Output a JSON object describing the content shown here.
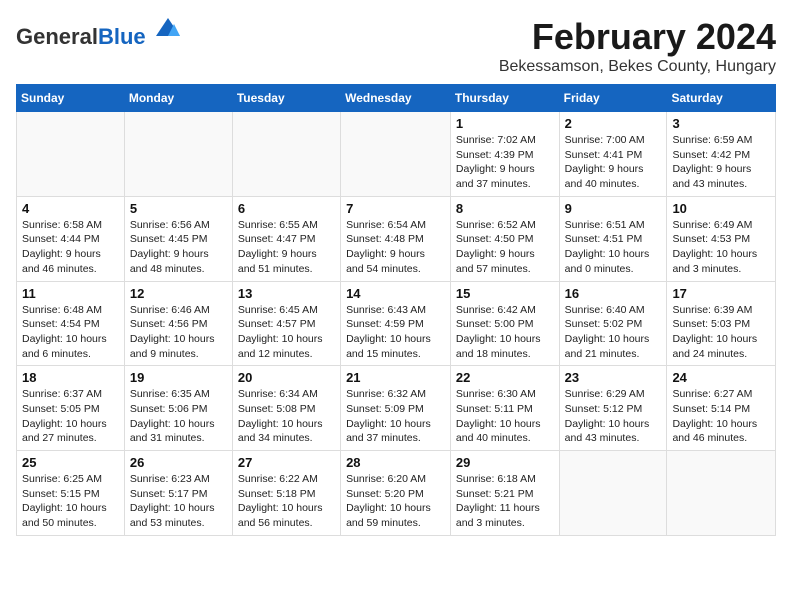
{
  "header": {
    "logo_general": "General",
    "logo_blue": "Blue",
    "month_title": "February 2024",
    "location": "Bekessamson, Bekes County, Hungary"
  },
  "days_of_week": [
    "Sunday",
    "Monday",
    "Tuesday",
    "Wednesday",
    "Thursday",
    "Friday",
    "Saturday"
  ],
  "weeks": [
    [
      {
        "day": "",
        "info": ""
      },
      {
        "day": "",
        "info": ""
      },
      {
        "day": "",
        "info": ""
      },
      {
        "day": "",
        "info": ""
      },
      {
        "day": "1",
        "info": "Sunrise: 7:02 AM\nSunset: 4:39 PM\nDaylight: 9 hours\nand 37 minutes."
      },
      {
        "day": "2",
        "info": "Sunrise: 7:00 AM\nSunset: 4:41 PM\nDaylight: 9 hours\nand 40 minutes."
      },
      {
        "day": "3",
        "info": "Sunrise: 6:59 AM\nSunset: 4:42 PM\nDaylight: 9 hours\nand 43 minutes."
      }
    ],
    [
      {
        "day": "4",
        "info": "Sunrise: 6:58 AM\nSunset: 4:44 PM\nDaylight: 9 hours\nand 46 minutes."
      },
      {
        "day": "5",
        "info": "Sunrise: 6:56 AM\nSunset: 4:45 PM\nDaylight: 9 hours\nand 48 minutes."
      },
      {
        "day": "6",
        "info": "Sunrise: 6:55 AM\nSunset: 4:47 PM\nDaylight: 9 hours\nand 51 minutes."
      },
      {
        "day": "7",
        "info": "Sunrise: 6:54 AM\nSunset: 4:48 PM\nDaylight: 9 hours\nand 54 minutes."
      },
      {
        "day": "8",
        "info": "Sunrise: 6:52 AM\nSunset: 4:50 PM\nDaylight: 9 hours\nand 57 minutes."
      },
      {
        "day": "9",
        "info": "Sunrise: 6:51 AM\nSunset: 4:51 PM\nDaylight: 10 hours\nand 0 minutes."
      },
      {
        "day": "10",
        "info": "Sunrise: 6:49 AM\nSunset: 4:53 PM\nDaylight: 10 hours\nand 3 minutes."
      }
    ],
    [
      {
        "day": "11",
        "info": "Sunrise: 6:48 AM\nSunset: 4:54 PM\nDaylight: 10 hours\nand 6 minutes."
      },
      {
        "day": "12",
        "info": "Sunrise: 6:46 AM\nSunset: 4:56 PM\nDaylight: 10 hours\nand 9 minutes."
      },
      {
        "day": "13",
        "info": "Sunrise: 6:45 AM\nSunset: 4:57 PM\nDaylight: 10 hours\nand 12 minutes."
      },
      {
        "day": "14",
        "info": "Sunrise: 6:43 AM\nSunset: 4:59 PM\nDaylight: 10 hours\nand 15 minutes."
      },
      {
        "day": "15",
        "info": "Sunrise: 6:42 AM\nSunset: 5:00 PM\nDaylight: 10 hours\nand 18 minutes."
      },
      {
        "day": "16",
        "info": "Sunrise: 6:40 AM\nSunset: 5:02 PM\nDaylight: 10 hours\nand 21 minutes."
      },
      {
        "day": "17",
        "info": "Sunrise: 6:39 AM\nSunset: 5:03 PM\nDaylight: 10 hours\nand 24 minutes."
      }
    ],
    [
      {
        "day": "18",
        "info": "Sunrise: 6:37 AM\nSunset: 5:05 PM\nDaylight: 10 hours\nand 27 minutes."
      },
      {
        "day": "19",
        "info": "Sunrise: 6:35 AM\nSunset: 5:06 PM\nDaylight: 10 hours\nand 31 minutes."
      },
      {
        "day": "20",
        "info": "Sunrise: 6:34 AM\nSunset: 5:08 PM\nDaylight: 10 hours\nand 34 minutes."
      },
      {
        "day": "21",
        "info": "Sunrise: 6:32 AM\nSunset: 5:09 PM\nDaylight: 10 hours\nand 37 minutes."
      },
      {
        "day": "22",
        "info": "Sunrise: 6:30 AM\nSunset: 5:11 PM\nDaylight: 10 hours\nand 40 minutes."
      },
      {
        "day": "23",
        "info": "Sunrise: 6:29 AM\nSunset: 5:12 PM\nDaylight: 10 hours\nand 43 minutes."
      },
      {
        "day": "24",
        "info": "Sunrise: 6:27 AM\nSunset: 5:14 PM\nDaylight: 10 hours\nand 46 minutes."
      }
    ],
    [
      {
        "day": "25",
        "info": "Sunrise: 6:25 AM\nSunset: 5:15 PM\nDaylight: 10 hours\nand 50 minutes."
      },
      {
        "day": "26",
        "info": "Sunrise: 6:23 AM\nSunset: 5:17 PM\nDaylight: 10 hours\nand 53 minutes."
      },
      {
        "day": "27",
        "info": "Sunrise: 6:22 AM\nSunset: 5:18 PM\nDaylight: 10 hours\nand 56 minutes."
      },
      {
        "day": "28",
        "info": "Sunrise: 6:20 AM\nSunset: 5:20 PM\nDaylight: 10 hours\nand 59 minutes."
      },
      {
        "day": "29",
        "info": "Sunrise: 6:18 AM\nSunset: 5:21 PM\nDaylight: 11 hours\nand 3 minutes."
      },
      {
        "day": "",
        "info": ""
      },
      {
        "day": "",
        "info": ""
      }
    ]
  ]
}
